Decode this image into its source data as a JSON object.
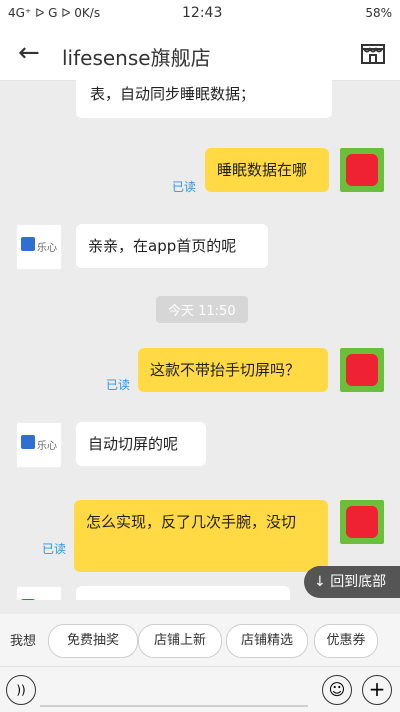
{
  "status": {
    "left": "4G⁺ ᐅ G ᐅ 0K/s",
    "time": "12:43",
    "right": "58%"
  },
  "header": {
    "title": "lifesense旗舰店",
    "back_icon": "arrow-left-icon",
    "shop_icon": "store-icon"
  },
  "chat": {
    "top_partial_text": "表，自动同步睡眠数据；",
    "messages": [
      {
        "side": "right",
        "text": "睡眠数据在哪",
        "read": "已读"
      },
      {
        "side": "left",
        "brand": "乐心",
        "text": "亲亲，在app首页的呢"
      },
      {
        "side": "time",
        "text": "今天 11:50"
      },
      {
        "side": "right",
        "text": "这款不带抬手切屏吗？",
        "read": "已读"
      },
      {
        "side": "left",
        "brand": "乐心",
        "text": "自动切屏的呢"
      },
      {
        "side": "right",
        "text": "怎么实现，反了几次手腕，没切",
        "read": "已读"
      }
    ],
    "partial_left_brand": "乐心"
  },
  "back_to_bottom": "回到底部",
  "quick_replies": {
    "label": "我想",
    "items": [
      "免费抽奖",
      "店铺上新",
      "店铺精选",
      "优惠券"
    ]
  },
  "inputbar": {
    "voice_icon": "voice-icon",
    "emoji_icon": "emoji-icon",
    "plus_icon": "plus-icon"
  }
}
